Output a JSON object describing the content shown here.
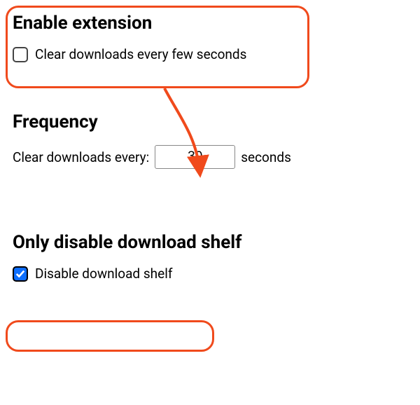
{
  "enable": {
    "heading": "Enable extension",
    "checkboxLabel": "Clear downloads every few seconds"
  },
  "frequency": {
    "heading": "Frequency",
    "prefix": "Clear downloads every:",
    "value": "30",
    "suffix": "seconds"
  },
  "shelf": {
    "heading": "Only disable download shelf",
    "checkboxLabel": "Disable download shelf"
  }
}
